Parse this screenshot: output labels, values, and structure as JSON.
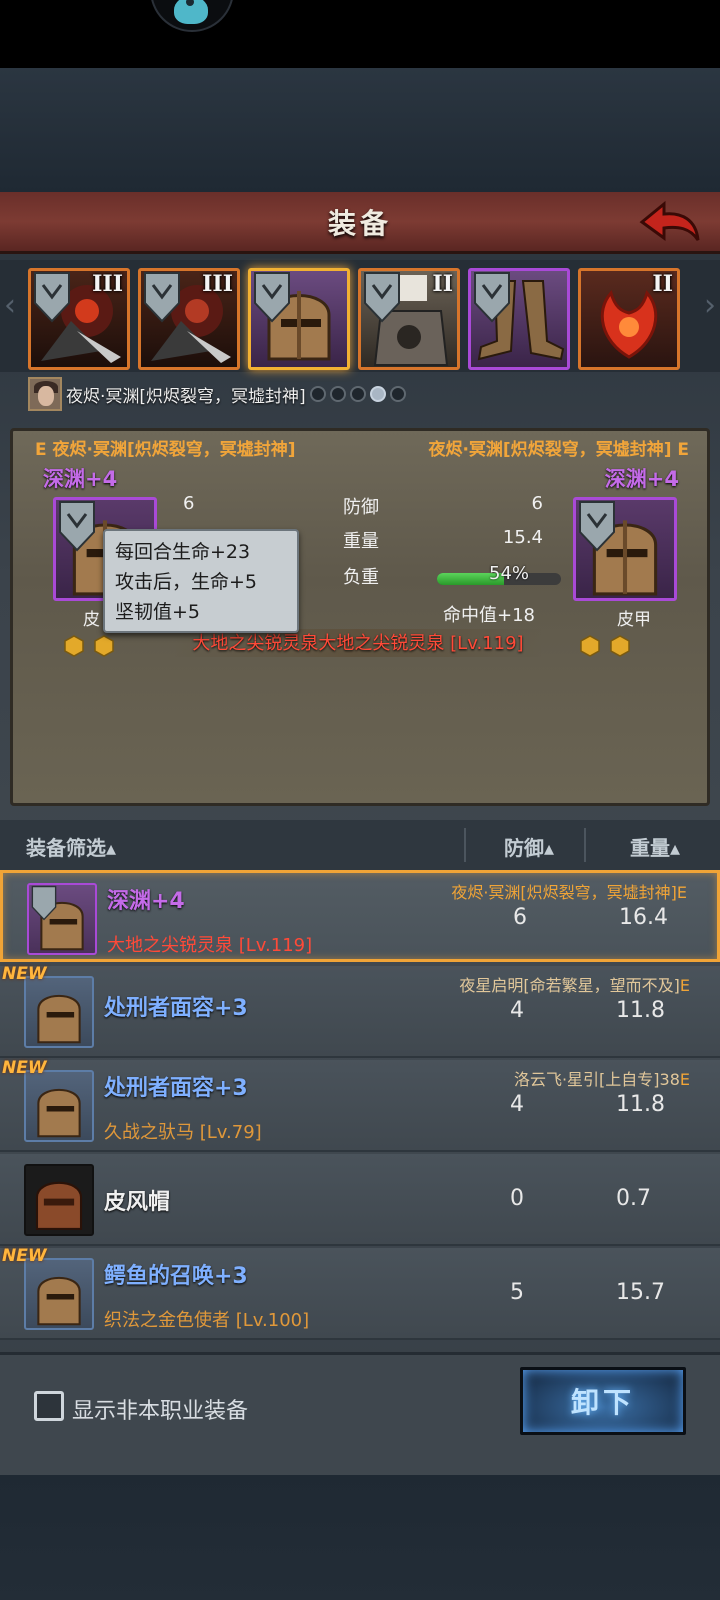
{
  "window": {
    "title": "装备"
  },
  "top_slots": [
    {
      "tier": "III",
      "icon": "dark-armor-icon"
    },
    {
      "tier": "III",
      "icon": "dark-armor-icon"
    },
    {
      "tier": "",
      "icon": "helmet-icon"
    },
    {
      "tier": "II",
      "icon": "chest-armor-icon"
    },
    {
      "tier": "",
      "icon": "boots-icon"
    },
    {
      "tier": "II",
      "icon": "phoenix-emblem-icon"
    }
  ],
  "owner": {
    "name": "夜烬·冥渊[炽烬裂穹，冥墟封神]"
  },
  "compare": {
    "owner_left": "E 夜烬·冥渊[炽烬裂穹，冥墟封神]",
    "owner_right": "夜烬·冥渊[炽烬裂穹，冥墟封神] E",
    "left_name": "深渊+4",
    "right_name": "深渊+4",
    "left_type": "皮",
    "right_type": "皮甲",
    "defense": {
      "label": "防御",
      "left": "6",
      "right": "6"
    },
    "weight": {
      "label": "重量",
      "right": "15.4"
    },
    "load": {
      "label": "负重",
      "percent": 54,
      "text": "54%"
    },
    "hit": "命中值+18",
    "enchant": "大地之尖锐灵泉大地之尖锐灵泉 [Lv.119]",
    "tooltip": {
      "line1": "每回合生命+23",
      "line2": "攻击后，生命+5",
      "line3": "坚韧值+5"
    }
  },
  "filter": {
    "label": "装备筛选▴",
    "defense": "防御▴",
    "weight": "重量▴"
  },
  "rows": [
    {
      "name": "深渊+4",
      "sub": "大地之尖锐灵泉 [Lv.119]",
      "owner": "夜烬·冥渊[炽烬裂穹，冥墟封神]",
      "owner_e": "E",
      "defense": "6",
      "weight": "16.4",
      "new": ""
    },
    {
      "name": "处刑者面容+3",
      "sub": "",
      "owner": "夜星启明[命若繁星，望而不及]",
      "owner_e": "E",
      "defense": "4",
      "weight": "11.8",
      "new": "NEW"
    },
    {
      "name": "处刑者面容+3",
      "sub": "久战之驮马 [Lv.79]",
      "owner": "洛云飞·星引[上自专]38",
      "owner_e": "E",
      "defense": "4",
      "weight": "11.8",
      "new": "NEW"
    },
    {
      "name": "皮风帽",
      "sub": "",
      "owner": "",
      "owner_e": "",
      "defense": "0",
      "weight": "0.7",
      "new": ""
    },
    {
      "name": "鳄鱼的召唤+3",
      "sub": "织法之金色使者 [Lv.100]",
      "owner": "",
      "owner_e": "",
      "defense": "5",
      "weight": "15.7",
      "new": "NEW"
    }
  ],
  "bottom": {
    "checkbox_label": "显示非本职业装备",
    "unequip": "卸下"
  },
  "colors": {
    "accent_orange": "#f0a437",
    "purple": "#a94ad7",
    "enchant_red": "#ff4a38",
    "name_blue": "#7fb0ff"
  }
}
